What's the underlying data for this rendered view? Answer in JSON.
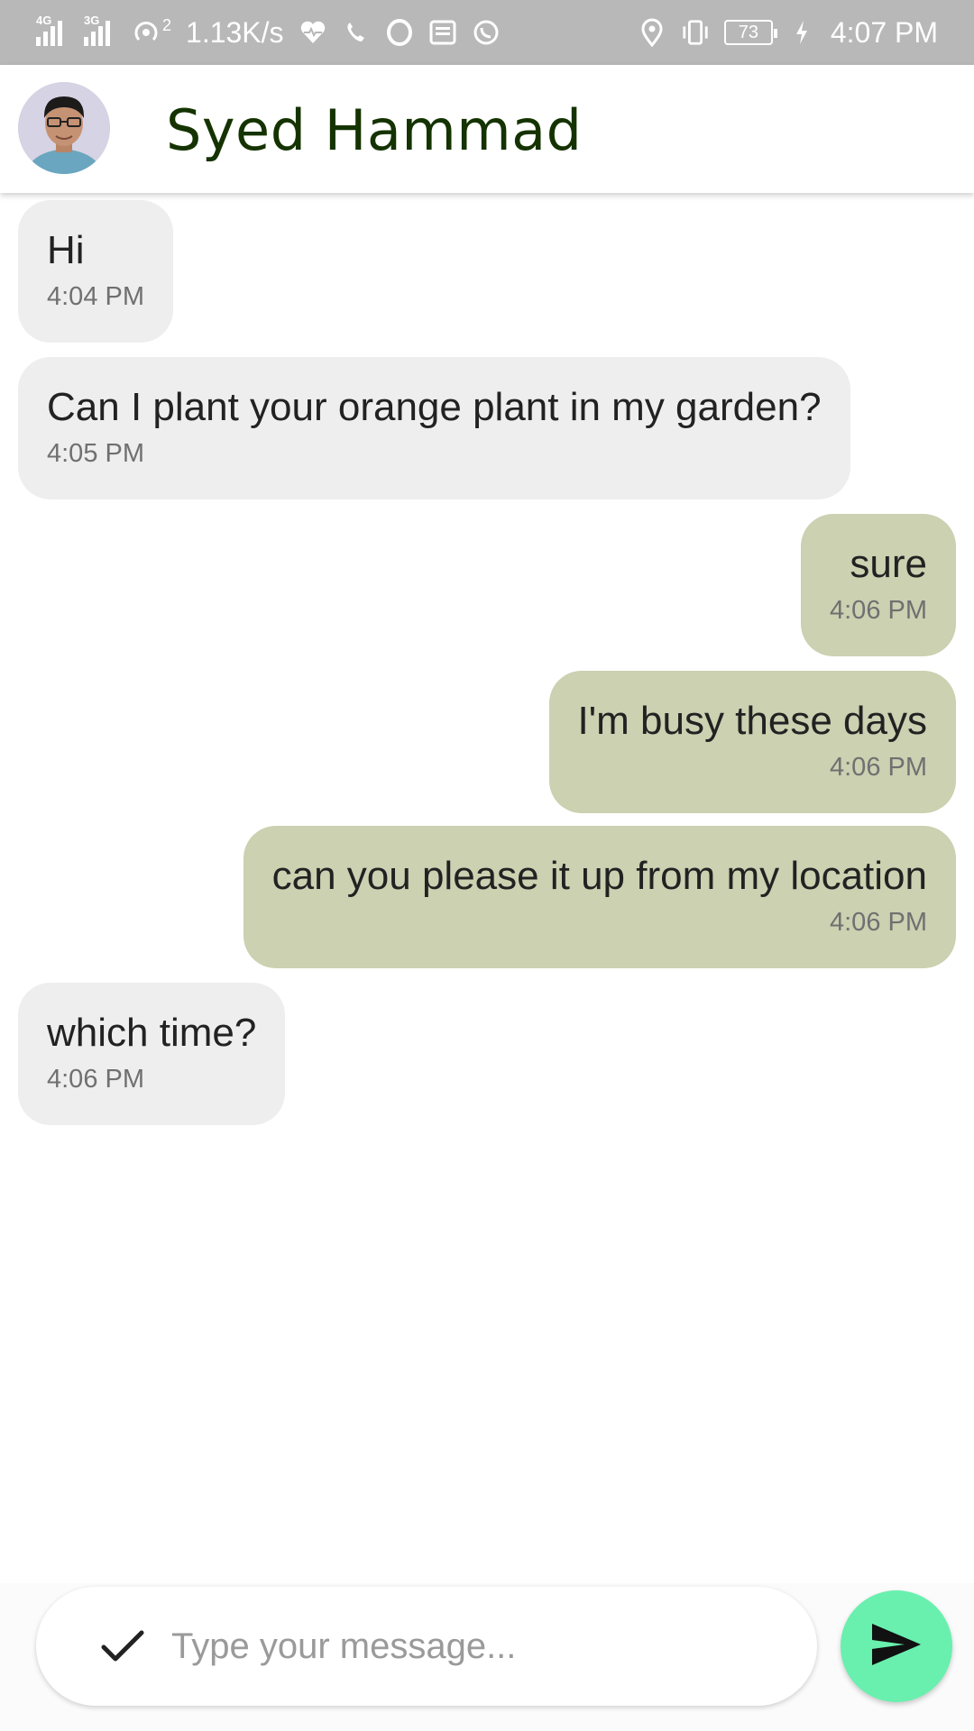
{
  "status_bar": {
    "network_1": "4G",
    "network_2": "3G",
    "hotspot_count": "2",
    "speed": "1.13K/s",
    "battery": "73",
    "time": "4:07 PM"
  },
  "header": {
    "contact_name": "Syed Hammad"
  },
  "messages": [
    {
      "text": "Hi",
      "time": "4:04 PM",
      "direction": "incoming"
    },
    {
      "text": "Can I plant your orange plant in my garden?",
      "time": "4:05 PM",
      "direction": "incoming"
    },
    {
      "text": "sure",
      "time": "4:06 PM",
      "direction": "outgoing"
    },
    {
      "text": "I'm busy these days",
      "time": "4:06 PM",
      "direction": "outgoing"
    },
    {
      "text": "can you please it up from my location",
      "time": "4:06 PM",
      "direction": "outgoing"
    },
    {
      "text": "which time?",
      "time": "4:06 PM",
      "direction": "incoming"
    }
  ],
  "composer": {
    "placeholder": "Type your message...",
    "value": ""
  },
  "colors": {
    "incoming_bubble": "#eeeeee",
    "outgoing_bubble": "#cbd1b1",
    "send_button": "#69f0ae",
    "name_color": "#143300",
    "status_bar": "#b8b8b8"
  },
  "icons": {
    "left_status": [
      "signal-icon",
      "signal-icon",
      "hotspot-icon",
      "heart-pulse-icon",
      "phone-icon",
      "opera-icon",
      "news-icon",
      "whatsapp-icon"
    ],
    "right_status": [
      "location-icon",
      "vibrate-icon",
      "battery-icon",
      "charging-icon"
    ],
    "composer": [
      "check-icon",
      "send-icon"
    ]
  }
}
